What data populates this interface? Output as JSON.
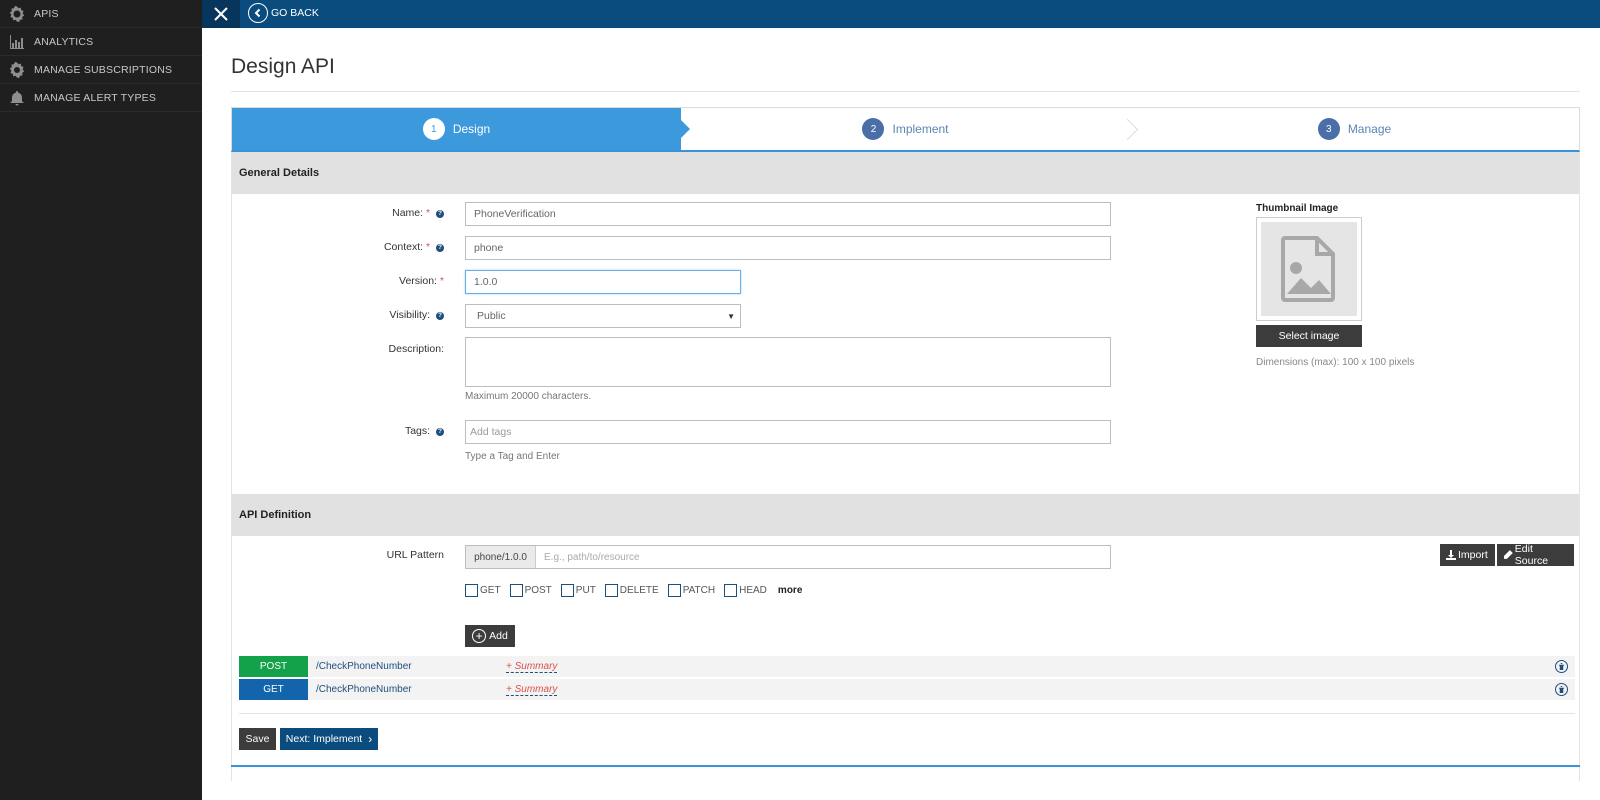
{
  "sidebar": {
    "items": [
      {
        "label": "APIS",
        "icon": "gear-api-icon"
      },
      {
        "label": "ANALYTICS",
        "icon": "bar-chart-icon"
      },
      {
        "label": "MANAGE SUBSCRIPTIONS",
        "icon": "gear-icon"
      },
      {
        "label": "MANAGE ALERT TYPES",
        "icon": "bell-icon"
      }
    ]
  },
  "topbar": {
    "go_back": "GO BACK",
    "close_icon": "close-icon"
  },
  "page": {
    "title": "Design API"
  },
  "wizard": {
    "steps": [
      {
        "num": "1",
        "label": "Design",
        "active": true
      },
      {
        "num": "2",
        "label": "Implement",
        "active": false
      },
      {
        "num": "3",
        "label": "Manage",
        "active": false
      }
    ]
  },
  "general": {
    "heading": "General Details",
    "name_label": "Name:",
    "name_value": "PhoneVerification",
    "context_label": "Context:",
    "context_value": "phone",
    "version_label": "Version:",
    "version_value": "1.0.0",
    "visibility_label": "Visibility:",
    "visibility_value": "Public",
    "description_label": "Description:",
    "description_value": "",
    "description_hint": "Maximum 20000 characters.",
    "tags_label": "Tags:",
    "tags_placeholder": "Add tags",
    "tags_hint": "Type a Tag and Enter",
    "required_mark": "*",
    "help_mark": "?",
    "thumbnail_title": "Thumbnail Image",
    "select_image": "Select image",
    "dimensions": "Dimensions (max): 100 x 100 pixels"
  },
  "api_definition": {
    "heading": "API Definition",
    "url_label": "URL Pattern",
    "url_prefix": "phone/1.0.0",
    "url_placeholder": "E.g., path/to/resource",
    "import_label": "Import",
    "edit_source_label": "Edit Source",
    "methods": [
      "GET",
      "POST",
      "PUT",
      "DELETE",
      "PATCH",
      "HEAD"
    ],
    "more": "more",
    "add_label": "Add",
    "resources": [
      {
        "verb": "POST",
        "path": "/CheckPhoneNumber",
        "summary": "+ Summary",
        "color": "#13a24a"
      },
      {
        "verb": "GET",
        "path": "/CheckPhoneNumber",
        "summary": "+ Summary",
        "color": "#1265ab"
      }
    ]
  },
  "actions": {
    "save": "Save",
    "next": "Next: Implement"
  },
  "colors": {
    "sidebar_bg": "#1f1f1f",
    "topbar_bg": "#0b4c7f",
    "active_step": "#3c99dc",
    "required": "#d9534f"
  }
}
